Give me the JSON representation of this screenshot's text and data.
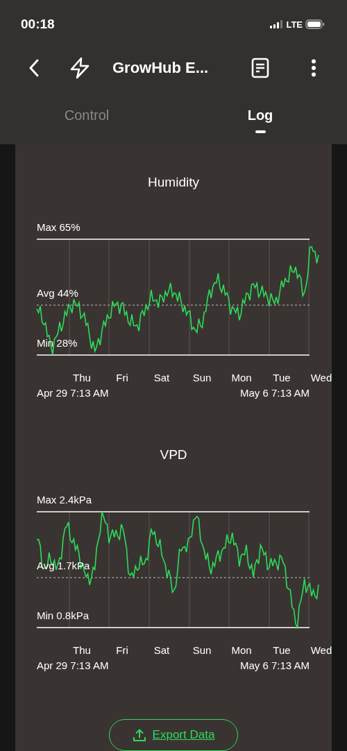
{
  "status_bar": {
    "time": "00:18",
    "network": "LTE"
  },
  "header": {
    "title": "GrowHub E..."
  },
  "tabs": [
    {
      "label": "Control",
      "selected": false
    },
    {
      "label": "Log",
      "selected": true
    }
  ],
  "charts": [
    {
      "title": "Humidity",
      "max_label": "Max 65%",
      "avg_label": "Avg 44%",
      "min_label": "Min 28%",
      "days": [
        "Thu",
        "Fri",
        "Sat",
        "Sun",
        "Mon",
        "Tue",
        "Wed"
      ],
      "start": "Apr 29 7:13 AM",
      "end": "May 6 7:13 AM"
    },
    {
      "title": "VPD",
      "max_label": "Max 2.4kPa",
      "avg_label": "Avg 1.7kPa",
      "min_label": "Min 0.8kPa",
      "days": [
        "Thu",
        "Fri",
        "Sat",
        "Sun",
        "Mon",
        "Tue",
        "Wed"
      ],
      "start": "Apr 29 7:13 AM",
      "end": "May 6 7:13 AM"
    }
  ],
  "export_button": {
    "label": "Export Data"
  }
}
